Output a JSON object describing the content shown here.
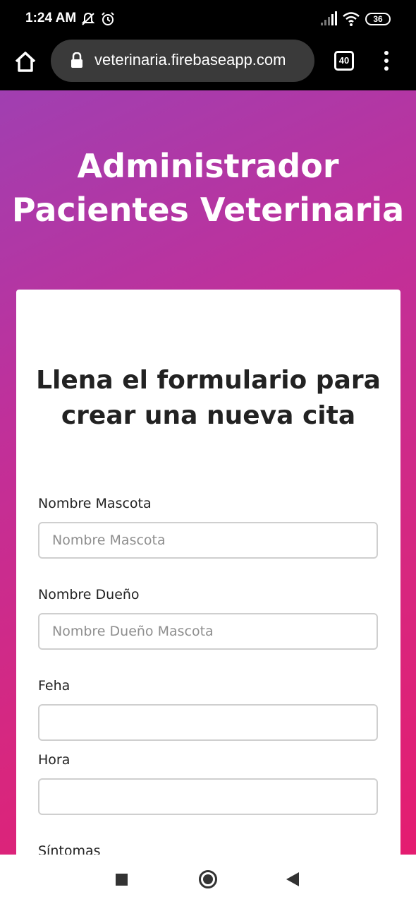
{
  "status_bar": {
    "time": "1:24 AM",
    "battery": "36",
    "icons": [
      "notifications-off-icon",
      "alarm-icon",
      "signal-icon",
      "wifi-icon",
      "battery-icon"
    ]
  },
  "browser": {
    "url": "veterinaria.firebaseapp.com",
    "tab_count": "40",
    "icons": [
      "home-icon",
      "lock-icon",
      "tabs-icon",
      "more-vert-icon"
    ]
  },
  "page": {
    "title": "Administrador Pacientes Veterinaria",
    "form": {
      "heading": "Llena el formulario para crear una nueva cita",
      "fields": [
        {
          "label": "Nombre Mascota",
          "placeholder": "Nombre Mascota",
          "value": ""
        },
        {
          "label": "Nombre Dueño",
          "placeholder": "Nombre Dueño Mascota",
          "value": ""
        },
        {
          "label": "Feha",
          "placeholder": "",
          "value": ""
        },
        {
          "label": "Hora",
          "placeholder": "",
          "value": ""
        },
        {
          "label": "Síntomas"
        }
      ]
    }
  },
  "nav_bar": {
    "icons": [
      "recents-icon",
      "home-circle-icon",
      "back-icon"
    ]
  },
  "colors": {
    "gradient_start": "#a03fb1",
    "gradient_end": "#e41c70"
  }
}
